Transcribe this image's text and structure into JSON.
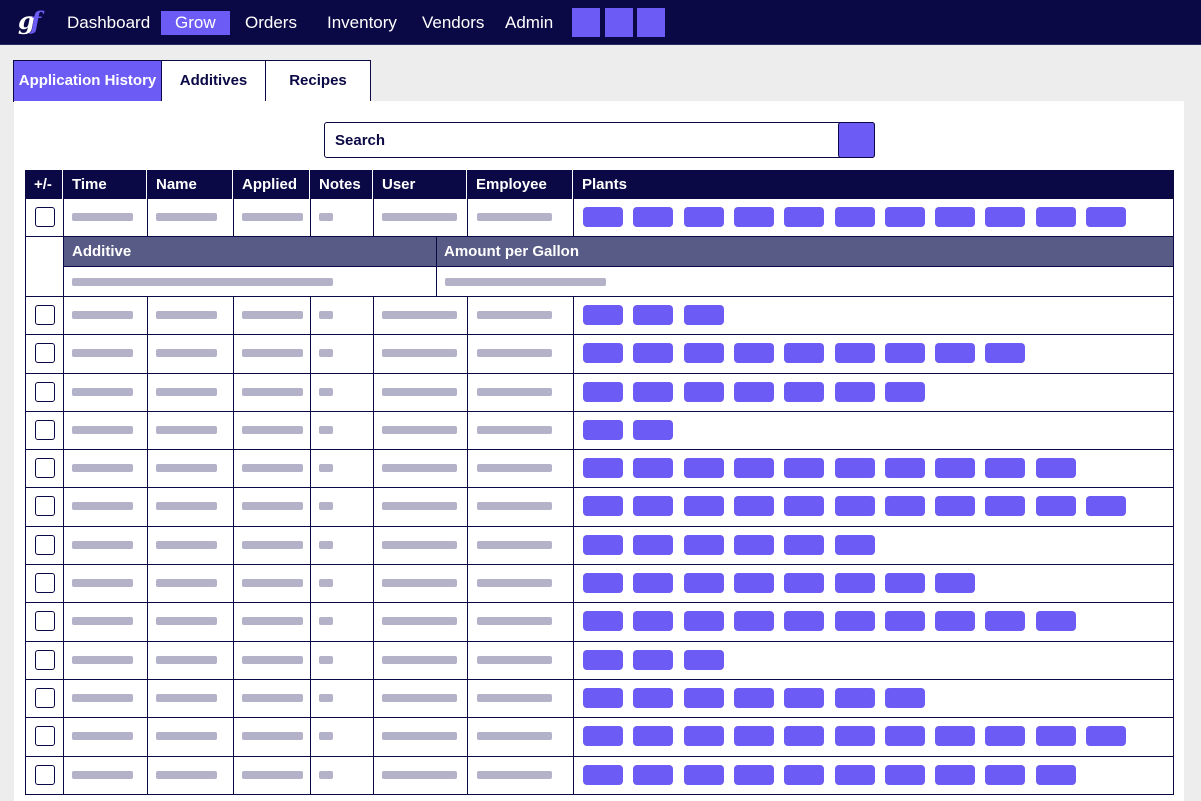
{
  "nav": {
    "logo": "gf",
    "items": [
      "Dashboard",
      "Grow",
      "Orders",
      "Inventory",
      "Vendors",
      "Admin"
    ],
    "active": "Grow"
  },
  "tabs": [
    "Application History",
    "Additives",
    "Recipes"
  ],
  "active_tab": "Application History",
  "search": {
    "placeholder": "Search"
  },
  "table": {
    "headers": [
      "+/-",
      "Time",
      "Name",
      "Applied",
      "Notes",
      "User",
      "Employee",
      "Plants"
    ],
    "expanded_headers": [
      "Additive",
      "Amount per Gallon"
    ],
    "plant_counts": [
      11,
      3,
      9,
      7,
      2,
      10,
      11,
      6,
      8,
      10,
      3,
      7,
      11,
      10
    ]
  },
  "colors": {
    "navy": "#0b0945",
    "accent": "#6c5cf5",
    "subheader": "#585b86",
    "placeholder_bar": "#b4b2c8"
  }
}
